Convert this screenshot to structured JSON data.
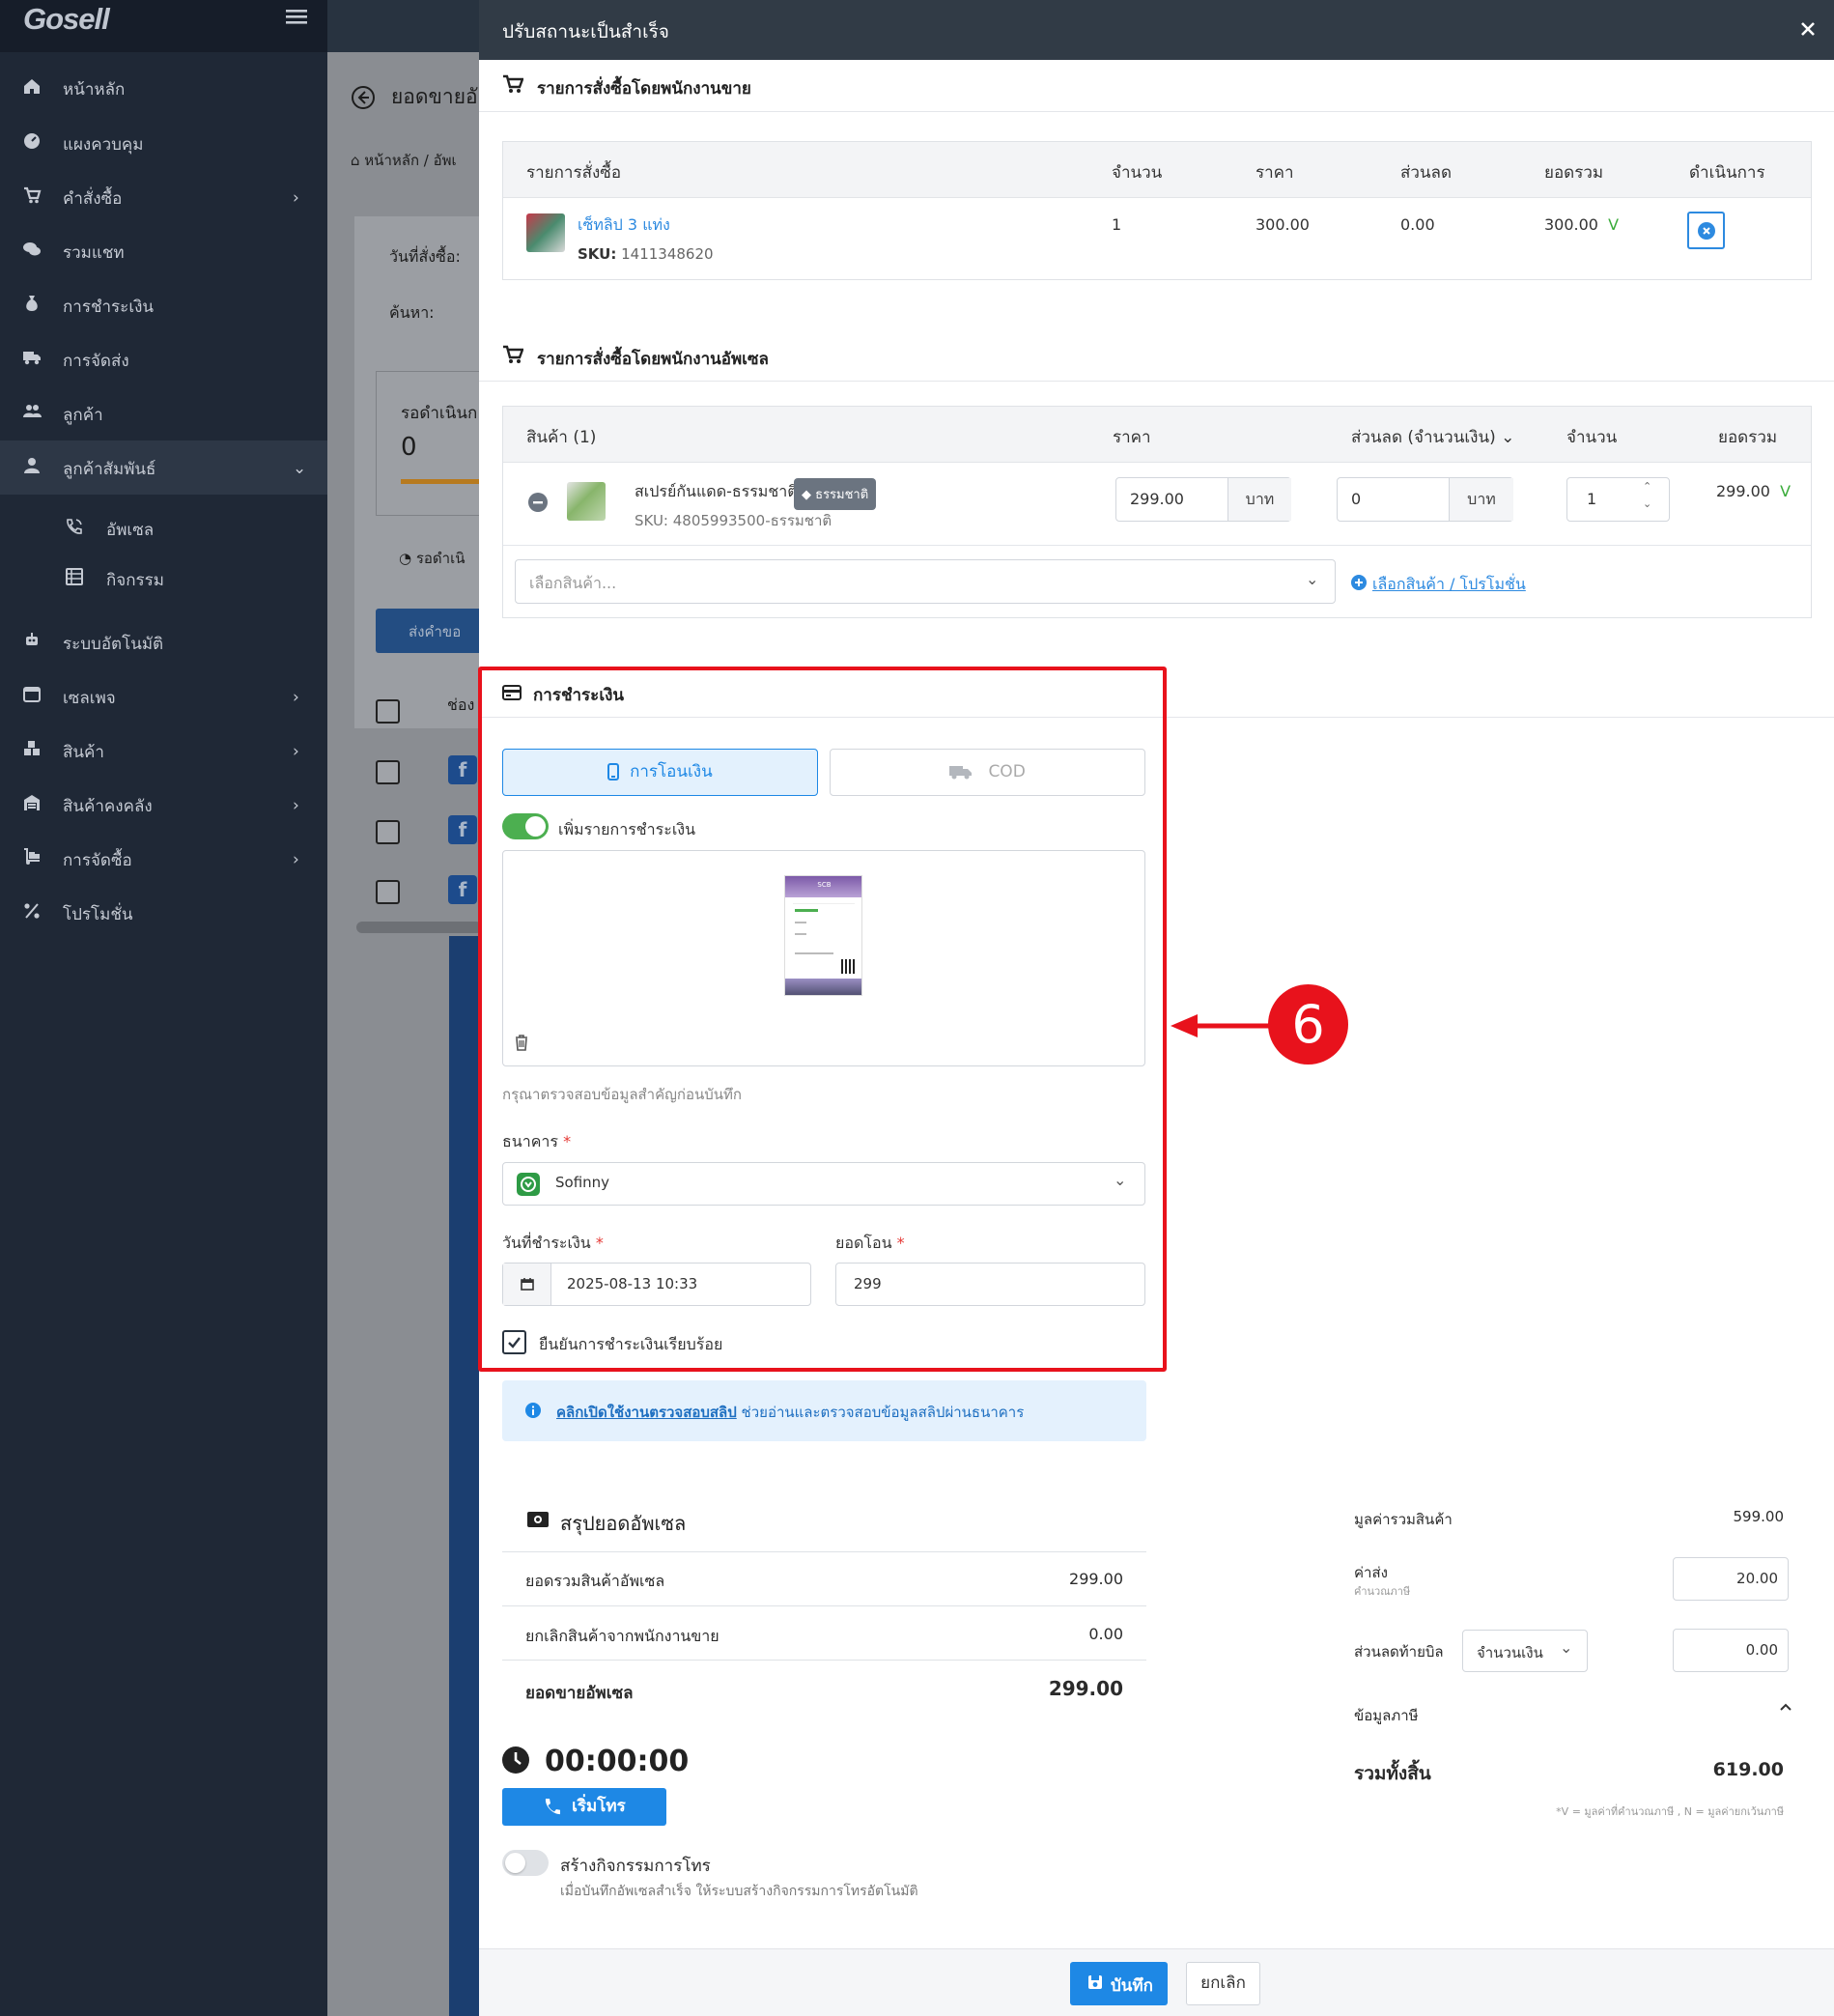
{
  "sidebar": {
    "logo": "Gosell",
    "items": [
      {
        "label": "หน้าหลัก",
        "icon": "home-icon",
        "chev": ""
      },
      {
        "label": "แผงควบคุม",
        "icon": "dashboard-icon",
        "chev": ""
      },
      {
        "label": "คำสั่งซื้อ",
        "icon": "cart-icon",
        "chev": "›"
      },
      {
        "label": "รวมแชท",
        "icon": "chat-icon",
        "chev": ""
      },
      {
        "label": "การชำระเงิน",
        "icon": "money-bag-icon",
        "chev": ""
      },
      {
        "label": "การจัดส่ง",
        "icon": "truck-icon",
        "chev": ""
      },
      {
        "label": "ลูกค้า",
        "icon": "users-icon",
        "chev": ""
      },
      {
        "label": "ลูกค้าสัมพันธ์",
        "icon": "user-tie-icon",
        "chev": "⌄"
      },
      {
        "label": "ระบบอัตโนมัติ",
        "icon": "robot-icon",
        "chev": ""
      },
      {
        "label": "เซลเพจ",
        "icon": "window-icon",
        "chev": "›"
      },
      {
        "label": "สินค้า",
        "icon": "boxes-icon",
        "chev": "›"
      },
      {
        "label": "สินค้าคงคลัง",
        "icon": "warehouse-icon",
        "chev": "›"
      },
      {
        "label": "การจัดซื้อ",
        "icon": "dolly-icon",
        "chev": "›"
      },
      {
        "label": "โปรโมชั่น",
        "icon": "percent-icon",
        "chev": ""
      }
    ],
    "sub_items": [
      {
        "label": "อัพเซล",
        "icon": "phone-volume-icon"
      },
      {
        "label": "กิจกรรม",
        "icon": "list-icon"
      }
    ]
  },
  "background_page": {
    "title": "ยอดขายอั",
    "breadcrumb": "หน้าหลัก / อัพเ",
    "date_label": "วันที่สั่งซื้อ:",
    "search_label": "ค้นหา:",
    "status_label": "รอดำเนินก",
    "status_count": "0",
    "tab_label": "รอดำเนิ",
    "button_label": "ส่งคำขอ",
    "col_label": "ช่อง"
  },
  "modal": {
    "title": "ปรับสถานะเป็นสำเร็จ",
    "sales_section_title": "รายการสั่งซื้อโดยพนักงานขาย",
    "sales_table": {
      "headers": [
        "รายการสั่งซื้อ",
        "จำนวน",
        "ราคา",
        "ส่วนลด",
        "ยอดรวม",
        "ดำเนินการ"
      ],
      "row": {
        "name": "เซ็ทลิป 3 แท่ง",
        "sku_label": "SKU:",
        "sku": "1411348620",
        "qty": "1",
        "price": "300.00",
        "discount": "0.00",
        "total": "300.00",
        "vat": "V"
      }
    },
    "upsell_section_title": "รายการสั่งซื้อโดยพนักงานอัพเซล",
    "upsell_table": {
      "headers": [
        "สินค้า (1)",
        "ราคา",
        "ส่วนลด (จำนวนเงิน)",
        "จำนวน",
        "ยอดรวม"
      ],
      "row": {
        "name": "สเปรย์กันแดด-ธรรมชาติ",
        "tag": "ธรรมชาติ",
        "sku": "SKU: 4805993500-ธรรมชาติ",
        "price": "299.00",
        "price_unit": "บาท",
        "discount": "0",
        "discount_unit": "บาท",
        "qty": "1",
        "total": "299.00",
        "vat": "V"
      },
      "select_placeholder": "เลือกสินค้า...",
      "promo_link": "เลือกสินค้า / โปรโมชั่น"
    },
    "payment": {
      "title": "การชำระเงิน",
      "method_transfer": "การโอนเงิน",
      "method_cod": "COD",
      "add_payment_label": "เพิ่มรายการชำระเงิน",
      "add_payment_on": true,
      "slip_header": "SCB",
      "notice": "กรุณาตรวจสอบข้อมูลสำคัญก่อนบันทึก",
      "bank_label": "ธนาคาร",
      "bank_value": "Sofinny",
      "date_label": "วันที่ชำระเงิน",
      "date_value": "2025-08-13 10:33",
      "amount_label": "ยอดโอน",
      "amount_value": "299",
      "confirm_label": "ยืนยันการชำระเงินเรียบร้อย",
      "confirm_checked": true,
      "required_mark": "*"
    },
    "info": {
      "link": "คลิกเปิดใช้งานตรวจสอบสลิป",
      "text": " ช่วยอ่านและตรวจสอบข้อมูลสลิปผ่านธนาคาร"
    },
    "upsell_summary": {
      "title": "สรุปยอดอัพเซล",
      "rows": [
        {
          "label": "ยอดรวมสินค้าอัพเซล",
          "value": "299.00"
        },
        {
          "label": "ยกเลิกสินค้าจากพนักงานขาย",
          "value": "0.00"
        }
      ],
      "total_label": "ยอดขายอัพเซล",
      "total_value": "299.00"
    },
    "call": {
      "timer": "00:00:00",
      "button": "เริ่มโทร",
      "activity_title": "สร้างกิจกรรมการโทร",
      "activity_desc": "เมื่อบันทึกอัพเซลสำเร็จ ให้ระบบสร้างกิจกรรมการโทรอัตโนมัติ",
      "activity_on": false
    },
    "order_summary": {
      "product_total_label": "มูลค่ารวมสินค้า",
      "product_total": "599.00",
      "shipping_label": "ค่าส่ง",
      "shipping_sub": "คำนวณภาษี",
      "shipping": "20.00",
      "bill_discount_label": "ส่วนลดท้ายบิล",
      "bill_discount_type": "จำนวนเงิน",
      "bill_discount": "0.00",
      "tax_label": "ข้อมูลภาษี",
      "grand_total_label": "รวมทั้งสิ้น",
      "grand_total": "619.00",
      "footnote": "*V = มูลค่าที่คำนวณภาษี , N = มูลค่ายกเว้นภาษี"
    },
    "footer": {
      "save": "บันทึก",
      "cancel": "ยกเลิก"
    }
  },
  "annotation": {
    "step": "6"
  },
  "colors": {
    "primary": "#1e88e5",
    "highlight": "#e8121c",
    "toggle_on": "#4caf50",
    "sidebar": "#1f2836",
    "modal_header": "#313b46"
  }
}
